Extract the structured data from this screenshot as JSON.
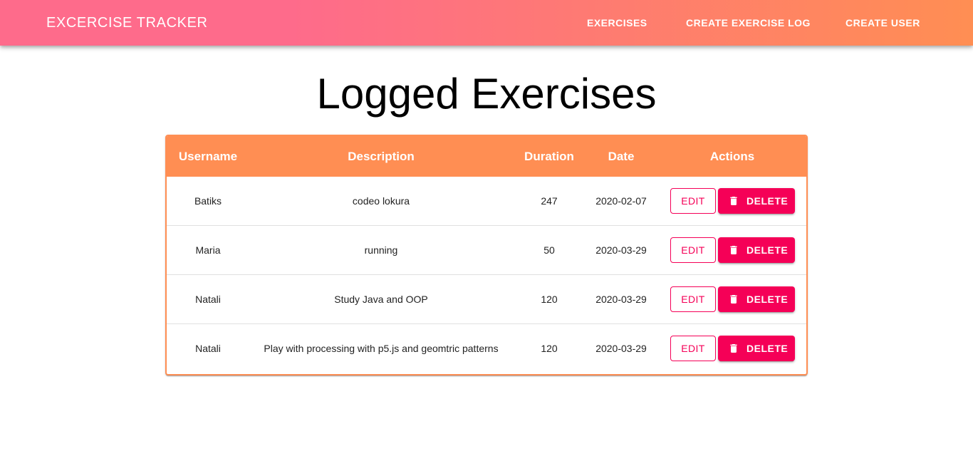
{
  "appbar": {
    "brand": "EXCERCISE TRACKER",
    "nav": [
      "EXERCISES",
      "CREATE EXERCISE LOG",
      "CREATE USER"
    ]
  },
  "page": {
    "title": "Logged Exercises"
  },
  "table": {
    "headers": [
      "Username",
      "Description",
      "Duration",
      "Date",
      "Actions"
    ],
    "rows": [
      {
        "username": "Batiks",
        "description": "codeo lokura",
        "duration": "247",
        "date": "2020-02-07",
        "edit": "EDIT",
        "delete": "DELETE"
      },
      {
        "username": "Maria",
        "description": "running",
        "duration": "50",
        "date": "2020-03-29",
        "edit": "EDIT",
        "delete": "DELETE"
      },
      {
        "username": "Natali",
        "description": "Study Java and OOP",
        "duration": "120",
        "date": "2020-03-29",
        "edit": "EDIT",
        "delete": "DELETE"
      },
      {
        "username": "Natali",
        "description": "Play with processing with p5.js and geomtric patterns",
        "duration": "120",
        "date": "2020-03-29",
        "edit": "EDIT",
        "delete": "DELETE"
      }
    ]
  },
  "icons": {
    "delete": "trash-icon"
  },
  "colors": {
    "gradient_start": "#fe6b8b",
    "gradient_end": "#ff8e53",
    "table_header": "#ff8e53",
    "secondary": "#f50057"
  }
}
